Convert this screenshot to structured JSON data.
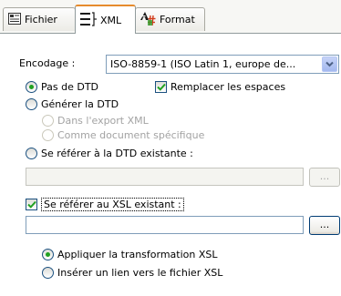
{
  "tabs": [
    {
      "label": "Fichier",
      "icon": "file-icon"
    },
    {
      "label": "XML",
      "icon": "xml-tree-icon"
    },
    {
      "label": "Format",
      "icon": "format-icon"
    }
  ],
  "active_tab": "XML",
  "encoding": {
    "label": "Encodage :",
    "value": "ISO-8859-1 (ISO Latin 1, europe de..."
  },
  "dtd": {
    "no_dtd_label": "Pas de DTD",
    "replace_spaces_label": "Remplacer les espaces",
    "generate_label": "Générer la DTD",
    "in_export_label": "Dans l'export XML",
    "as_document_label": "Comme document spécifique",
    "existing_label": "Se référer à la DTD existante :",
    "existing_path": "",
    "browse_label": "..."
  },
  "xsl": {
    "existing_label": "Se référer au XSL existant :",
    "existing_path": "",
    "browse_label": "...",
    "apply_label": "Appliquer la transformation XSL",
    "insert_link_label": "Insérer un lien vers le fichier XSL"
  },
  "colors": {
    "active_tab_accent": "#e68b2c",
    "radio_dot": "#21a121",
    "check_mark": "#21a121",
    "field_border": "#7f9db9"
  }
}
